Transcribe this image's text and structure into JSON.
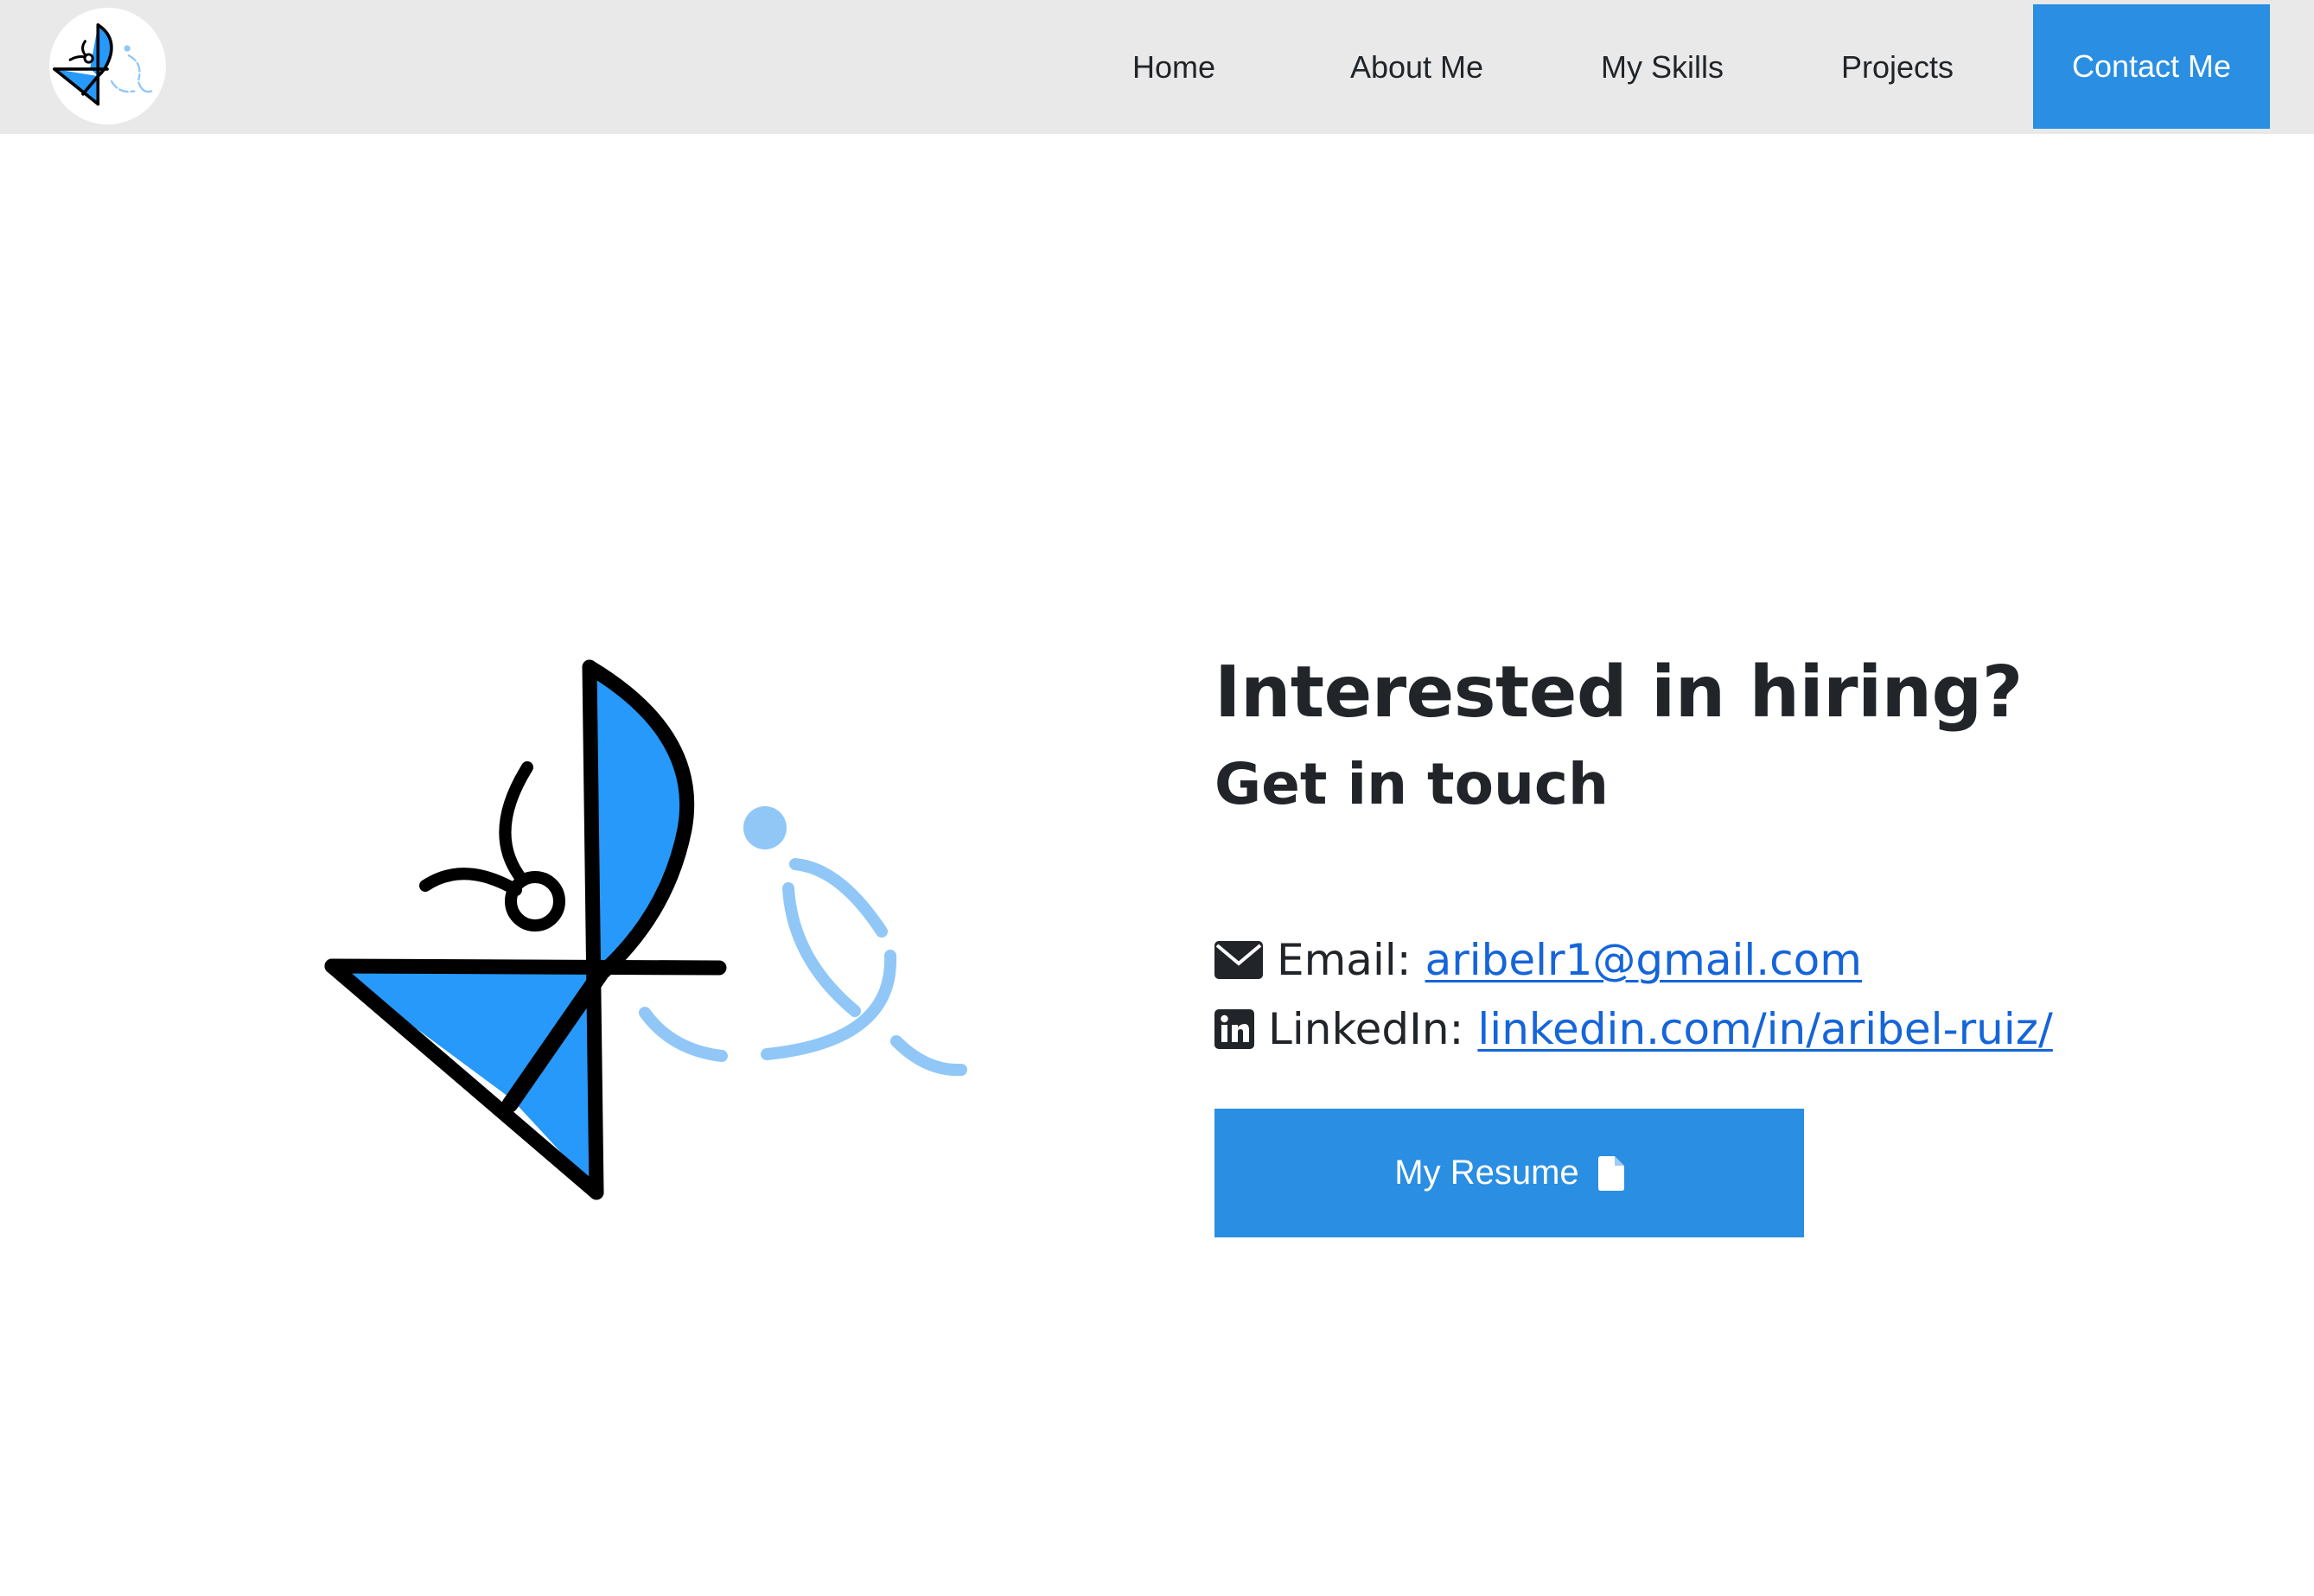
{
  "nav": {
    "logo_icon": "brand-logo-icon",
    "items": [
      {
        "label": "Home"
      },
      {
        "label": "About Me"
      },
      {
        "label": "My Skills"
      },
      {
        "label": "Projects"
      },
      {
        "label": "Contact Me"
      }
    ],
    "active_color": "#2a8ee2",
    "bar_color": "#e9e9e9"
  },
  "contact": {
    "headline": "Interested in hiring?",
    "subheadline": "Get in touch",
    "email_label": "Email:",
    "email_value": "aribelr1@gmail.com",
    "email_icon": "envelope-icon",
    "linkedin_label": "LinkedIn:",
    "linkedin_value": "linkedin.com/in/aribel-ruiz/",
    "linkedin_icon": "linkedin-icon",
    "resume_label": "My Resume",
    "resume_icon": "file-icon",
    "link_color": "#1565d8",
    "button_color": "#2a8ee2"
  },
  "hero": {
    "logo_icon": "brand-illustration-icon",
    "primary_color": "#2699fb",
    "secondary_color": "#90c7f7"
  }
}
